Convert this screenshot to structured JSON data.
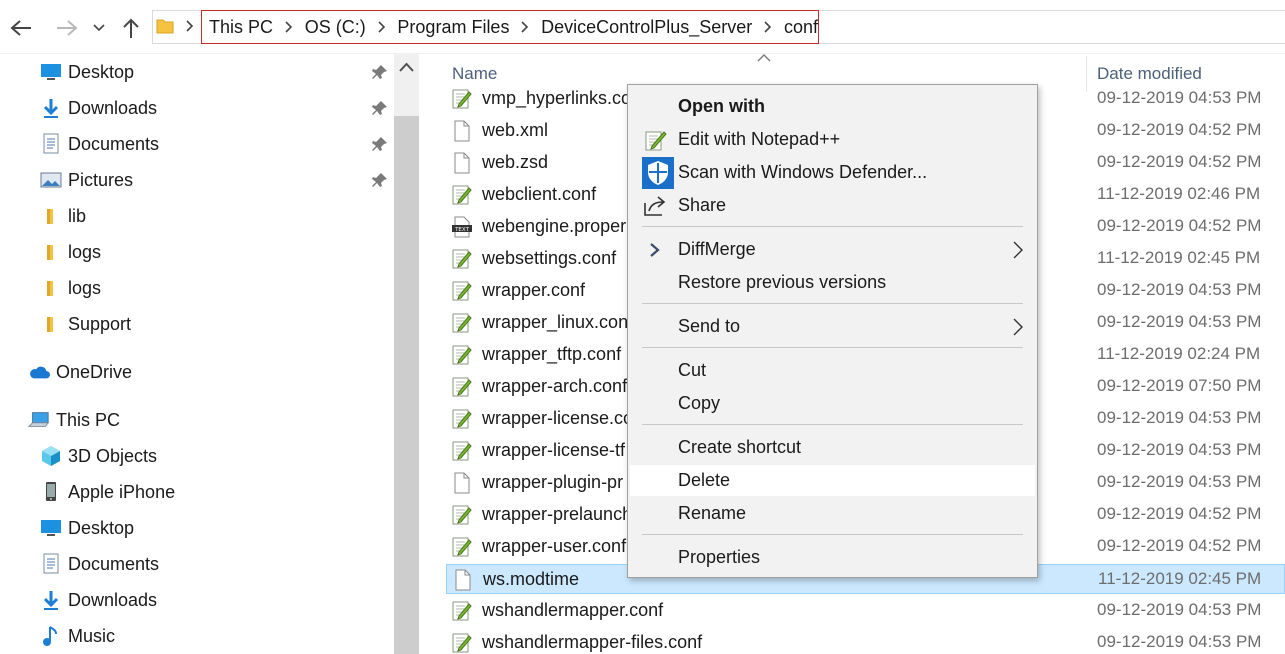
{
  "address_bar": {
    "crumbs": [
      "This PC",
      "OS (C:)",
      "Program Files",
      "DeviceControlPlus_Server",
      "conf"
    ]
  },
  "nav_pane": {
    "quick_access": [
      {
        "label": "Desktop",
        "icon": "desktop-icon",
        "pinned": true
      },
      {
        "label": "Downloads",
        "icon": "download-icon",
        "pinned": true
      },
      {
        "label": "Documents",
        "icon": "documents-icon",
        "pinned": true
      },
      {
        "label": "Pictures",
        "icon": "pictures-icon",
        "pinned": true
      },
      {
        "label": "lib",
        "icon": "folder-icon",
        "pinned": false
      },
      {
        "label": "logs",
        "icon": "folder-icon",
        "pinned": false
      },
      {
        "label": "logs",
        "icon": "folder-icon",
        "pinned": false
      },
      {
        "label": "Support",
        "icon": "folder-icon",
        "pinned": false
      }
    ],
    "onedrive": "OneDrive",
    "this_pc": "This PC",
    "this_pc_items": [
      {
        "label": "3D Objects",
        "icon": "3d-objects-icon"
      },
      {
        "label": "Apple iPhone",
        "icon": "phone-icon"
      },
      {
        "label": "Desktop",
        "icon": "desktop-icon"
      },
      {
        "label": "Documents",
        "icon": "documents-icon"
      },
      {
        "label": "Downloads",
        "icon": "download-icon"
      },
      {
        "label": "Music",
        "icon": "music-icon"
      }
    ]
  },
  "file_list": {
    "col_name": "Name",
    "col_date": "Date modified",
    "rows": [
      {
        "name": "vmp_hyperlinks.co",
        "date": "09-12-2019 04:53 PM",
        "icon": "conf"
      },
      {
        "name": "web.xml",
        "date": "09-12-2019 04:52 PM",
        "icon": "blank"
      },
      {
        "name": "web.zsd",
        "date": "09-12-2019 04:52 PM",
        "icon": "blank"
      },
      {
        "name": "webclient.conf",
        "date": "11-12-2019 02:46 PM",
        "icon": "conf"
      },
      {
        "name": "webengine.proper",
        "date": "09-12-2019 04:52 PM",
        "icon": "text"
      },
      {
        "name": "websettings.conf",
        "date": "11-12-2019 02:45 PM",
        "icon": "conf"
      },
      {
        "name": "wrapper.conf",
        "date": "09-12-2019 04:53 PM",
        "icon": "conf"
      },
      {
        "name": "wrapper_linux.conf",
        "date": "09-12-2019 04:53 PM",
        "icon": "conf"
      },
      {
        "name": "wrapper_tftp.conf",
        "date": "11-12-2019 02:24 PM",
        "icon": "conf"
      },
      {
        "name": "wrapper-arch.conf",
        "date": "09-12-2019 07:50 PM",
        "icon": "conf"
      },
      {
        "name": "wrapper-license.co",
        "date": "09-12-2019 04:53 PM",
        "icon": "conf"
      },
      {
        "name": "wrapper-license-tf",
        "date": "09-12-2019 04:53 PM",
        "icon": "conf"
      },
      {
        "name": "wrapper-plugin-pr",
        "date": "09-12-2019 04:53 PM",
        "icon": "blank"
      },
      {
        "name": "wrapper-prelaunch",
        "date": "09-12-2019 04:52 PM",
        "icon": "conf"
      },
      {
        "name": "wrapper-user.conf",
        "date": "09-12-2019 04:52 PM",
        "icon": "conf"
      },
      {
        "name": "ws.modtime",
        "date": "11-12-2019 02:45 PM",
        "icon": "blank",
        "selected": true
      },
      {
        "name": "wshandlermapper.conf",
        "date": "09-12-2019 04:53 PM",
        "icon": "conf"
      },
      {
        "name": "wshandlermapper-files.conf",
        "date": "09-12-2019 04:53 PM",
        "icon": "conf"
      }
    ]
  },
  "context_menu": {
    "open_with": "Open with",
    "edit_notepad": "Edit with Notepad++",
    "scan_defender": "Scan with Windows Defender...",
    "share": "Share",
    "diffmerge": "DiffMerge",
    "restore": "Restore previous versions",
    "send_to": "Send to",
    "cut": "Cut",
    "copy": "Copy",
    "create_shortcut": "Create shortcut",
    "delete": "Delete",
    "rename": "Rename",
    "properties": "Properties",
    "hovered_item": "Delete"
  },
  "colors": {
    "selection": "#cce8ff",
    "address_highlight": "#c42b2b",
    "defender_blue": "#1a6fc9",
    "folder_yellow": "#f5c342"
  }
}
